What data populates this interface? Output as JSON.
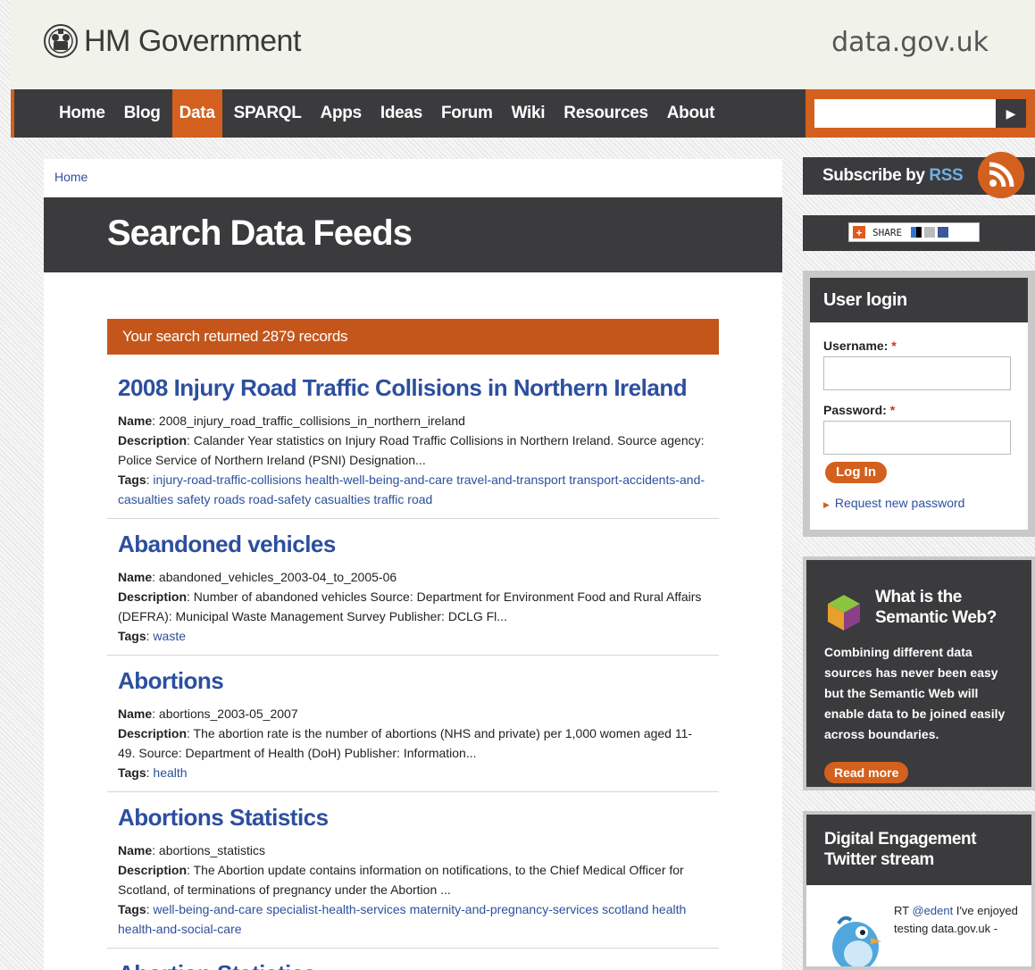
{
  "header": {
    "brand": "HM Government",
    "site_name": "data.gov.uk"
  },
  "nav": {
    "items": [
      {
        "label": "Home",
        "active": false
      },
      {
        "label": "Blog",
        "active": false
      },
      {
        "label": "Data",
        "active": true
      },
      {
        "label": "SPARQL",
        "active": false
      },
      {
        "label": "Apps",
        "active": false
      },
      {
        "label": "Ideas",
        "active": false
      },
      {
        "label": "Forum",
        "active": false
      },
      {
        "label": "Wiki",
        "active": false
      },
      {
        "label": "Resources",
        "active": false
      },
      {
        "label": "About",
        "active": false
      }
    ],
    "search": {
      "value": "",
      "button_glyph": "▶"
    }
  },
  "main": {
    "breadcrumb": "Home",
    "page_title": "Search Data Feeds",
    "result_count_text": "Your search returned 2879 records",
    "labels": {
      "name": "Name",
      "description": "Description",
      "tags": "Tags"
    },
    "results": [
      {
        "title": "2008 Injury Road Traffic Collisions in Northern Ireland",
        "name": "2008_injury_road_traffic_collisions_in_northern_ireland",
        "description": "Calander Year statistics on Injury Road Traffic Collisions in Northern Ireland. Source agency: Police Service of Northern Ireland (PSNI) Designation...",
        "tags": [
          "injury-road-traffic-collisions",
          "health-well-being-and-care",
          "travel-and-transport",
          "transport-accidents-and-casualties",
          "safety",
          "roads",
          "road-safety",
          "casualties",
          "traffic",
          "road"
        ]
      },
      {
        "title": "Abandoned vehicles",
        "name": "abandoned_vehicles_2003-04_to_2005-06",
        "description": "Number of abandoned vehicles Source: Department for Environment Food and Rural Affairs (DEFRA): Municipal Waste Management Survey Publisher: DCLG Fl...",
        "tags": [
          "waste"
        ]
      },
      {
        "title": "Abortions",
        "name": "abortions_2003-05_2007",
        "description": "The abortion rate is the number of abortions (NHS and private) per 1,000 women aged 11-49. Source: Department of Health (DoH) Publisher: Information...",
        "tags": [
          "health"
        ]
      },
      {
        "title": "Abortions Statistics",
        "name": "abortions_statistics",
        "description": "The Abortion update contains information on notifications, to the Chief Medical Officer for Scotland, of terminations of pregnancy under the Abortion ...",
        "tags": [
          "well-being-and-care",
          "specialist-health-services",
          "maternity-and-pregnancy-services",
          "scotland",
          "health",
          "health-and-social-care"
        ]
      },
      {
        "title": "Abortion Statistics",
        "name": "",
        "description": "",
        "tags": []
      }
    ]
  },
  "sidebar": {
    "rss": {
      "prefix": "Subscribe by ",
      "word": "RSS"
    },
    "share": {
      "label": "SHARE"
    },
    "login": {
      "title": "User login",
      "username_label": "Username:",
      "password_label": "Password:",
      "required_mark": "*",
      "username_value": "",
      "password_value": "",
      "login_button": "Log In",
      "request_password": "Request new password"
    },
    "semantic_web": {
      "title": "What is the Semantic Web?",
      "text": "Combining different data sources has never been easy but the Semantic Web will enable data to be joined easily across boundaries.",
      "read_more": "Read more"
    },
    "twitter": {
      "title": "Digital Engagement Twitter stream",
      "tweet_prefix": "RT ",
      "tweet_mention": "@edent",
      "tweet_text": " I've enjoyed testing data.gov.uk -"
    }
  },
  "colors": {
    "accent": "#d3601e",
    "dark": "#3b3a3c",
    "link": "#2c4f9e"
  }
}
